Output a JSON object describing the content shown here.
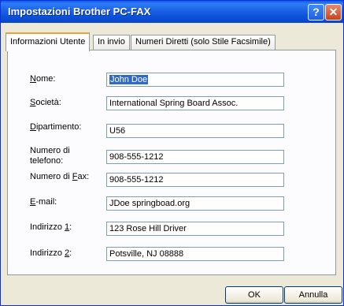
{
  "window": {
    "title": "Impostazioni Brother PC-FAX",
    "help_glyph": "?",
    "close_glyph": "✕"
  },
  "tabs": [
    {
      "label": "Informazioni Utente"
    },
    {
      "label": "In invio"
    },
    {
      "label": "Numeri Diretti (solo Stile Facsimile)"
    }
  ],
  "form": {
    "name": {
      "label_pre": "",
      "label_key": "N",
      "label_post": "ome:",
      "value": "John Doe"
    },
    "company": {
      "label_pre": "",
      "label_key": "S",
      "label_post": "ocietà:",
      "value": "International Spring Board Assoc."
    },
    "department": {
      "label_pre": "",
      "label_key": "D",
      "label_post": "ipartimento:",
      "value": "U56"
    },
    "phone": {
      "label": "Numero di telefono:",
      "value": "908-555-1212"
    },
    "fax": {
      "label_pre": "Numero di ",
      "label_key": "F",
      "label_post": "ax:",
      "value": "908-555-1212"
    },
    "email": {
      "label_pre": "",
      "label_key": "E",
      "label_post": "-mail:",
      "value": "JDoe springboad.org"
    },
    "address1": {
      "label_pre": "Indirizzo ",
      "label_key": "1",
      "label_post": ":",
      "value": "123 Rose Hill Driver"
    },
    "address2": {
      "label_pre": "Indirizzo ",
      "label_key": "2",
      "label_post": ":",
      "value": "Potsville, NJ 08888"
    }
  },
  "buttons": {
    "ok": "OK",
    "cancel": "Annulla"
  }
}
